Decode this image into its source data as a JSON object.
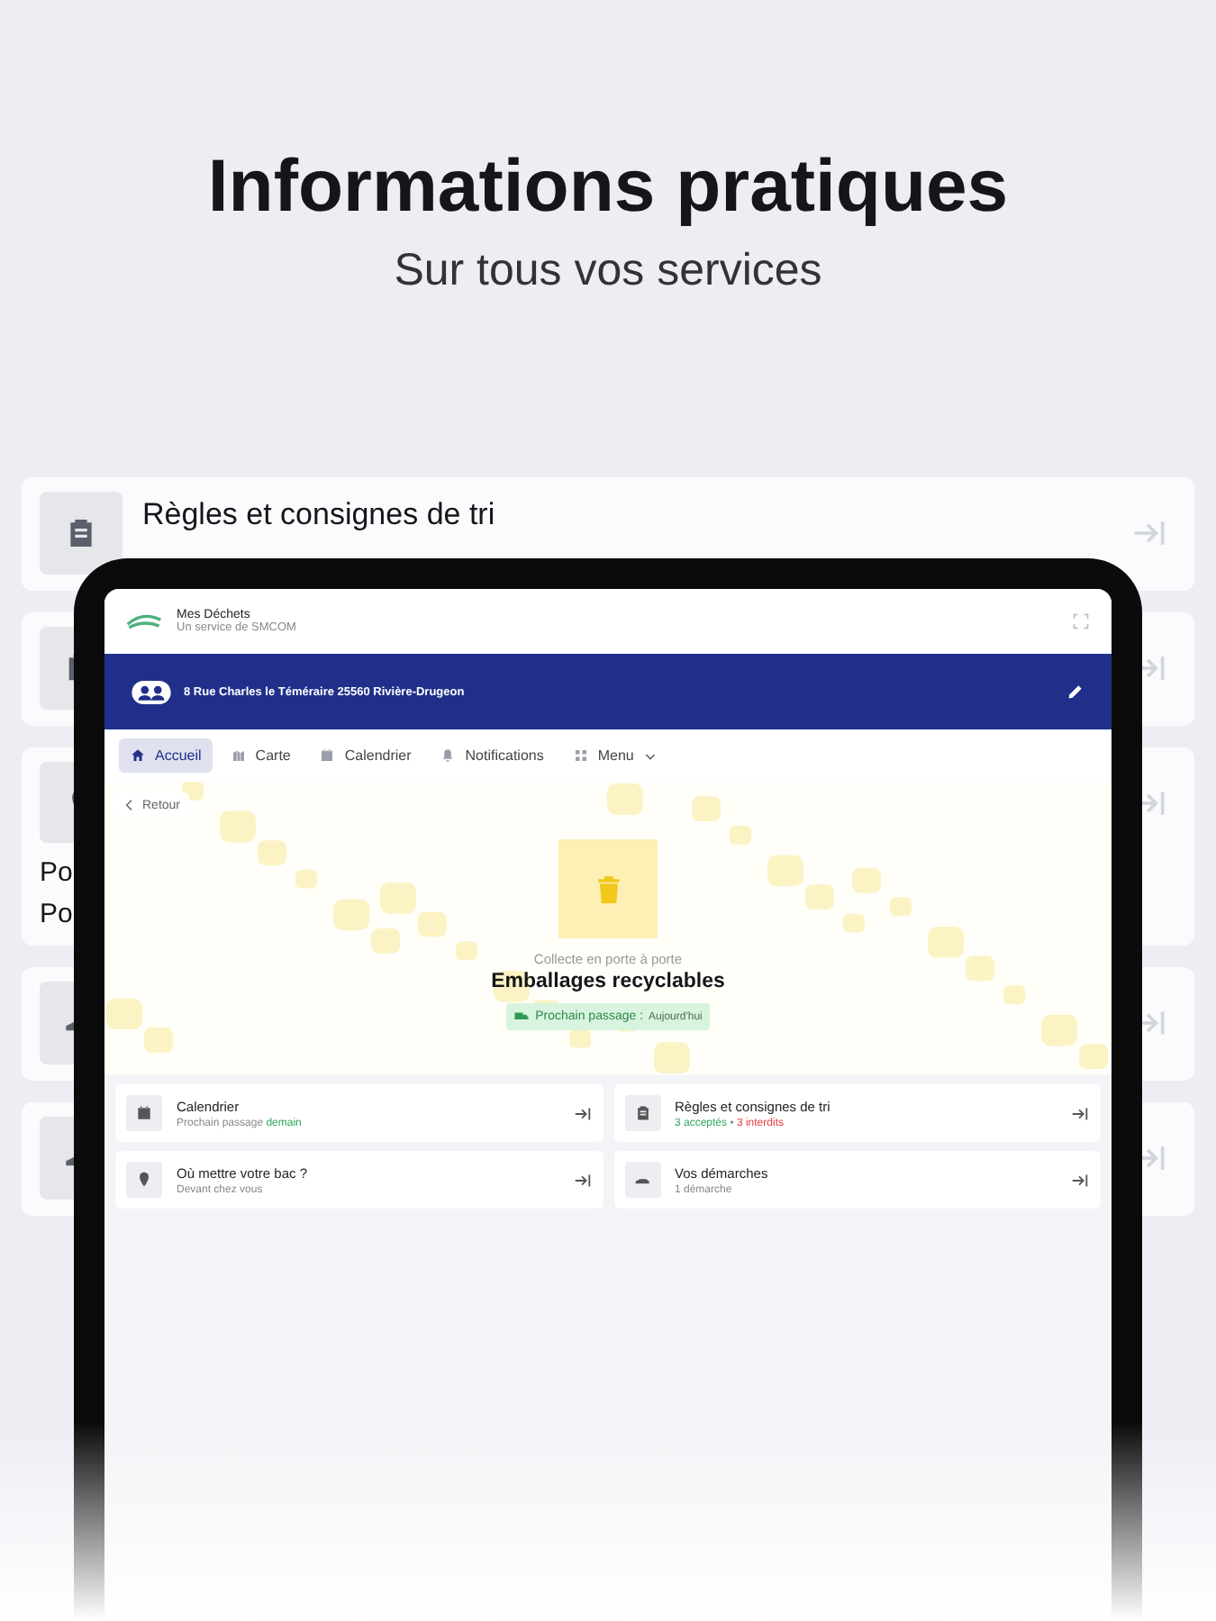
{
  "headline": {
    "title": "Informations pratiques",
    "subtitle": "Sur tous vos services"
  },
  "background_cards": [
    {
      "kind": "titled",
      "title": "Règles et consignes de tri"
    },
    {
      "kind": "plain"
    },
    {
      "kind": "text",
      "lines": [
        "Po",
        "Po"
      ]
    },
    {
      "kind": "plain"
    },
    {
      "kind": "plain"
    }
  ],
  "app": {
    "name": "Mes Déchets",
    "provider": "Un service de SMCOM",
    "address": "8 Rue Charles le Téméraire 25560 Rivière-Drugeon",
    "tabs": [
      {
        "label": "Accueil",
        "selected": true,
        "dropdown": false
      },
      {
        "label": "Carte",
        "selected": false,
        "dropdown": false
      },
      {
        "label": "Calendrier",
        "selected": false,
        "dropdown": false
      },
      {
        "label": "Notifications",
        "selected": false,
        "dropdown": false
      },
      {
        "label": "Menu",
        "selected": false,
        "dropdown": true
      }
    ],
    "back": "Retour",
    "stream": {
      "caption": "Collecte en porte à porte",
      "title": "Emballages recyclables",
      "next_label": "Prochain passage :",
      "next_value": "Aujourd'hui"
    },
    "shortcuts": [
      {
        "title": "Calendrier",
        "sub": [
          {
            "text": "Prochain passage ",
            "kind": "muted"
          },
          {
            "text": "demain",
            "kind": "ok"
          }
        ]
      },
      {
        "title": "Règles et consignes de tri",
        "sub": [
          {
            "text": "3 acceptés",
            "kind": "ok"
          },
          {
            "text": " • ",
            "kind": "muted"
          },
          {
            "text": "3 interdits",
            "kind": "bad"
          }
        ]
      },
      {
        "title": "Où mettre votre bac ?",
        "sub": [
          {
            "text": "Devant chez vous",
            "kind": "muted"
          }
        ]
      },
      {
        "title": "Vos démarches",
        "sub": [
          {
            "text": "1 démarche",
            "kind": "muted"
          }
        ]
      }
    ]
  }
}
